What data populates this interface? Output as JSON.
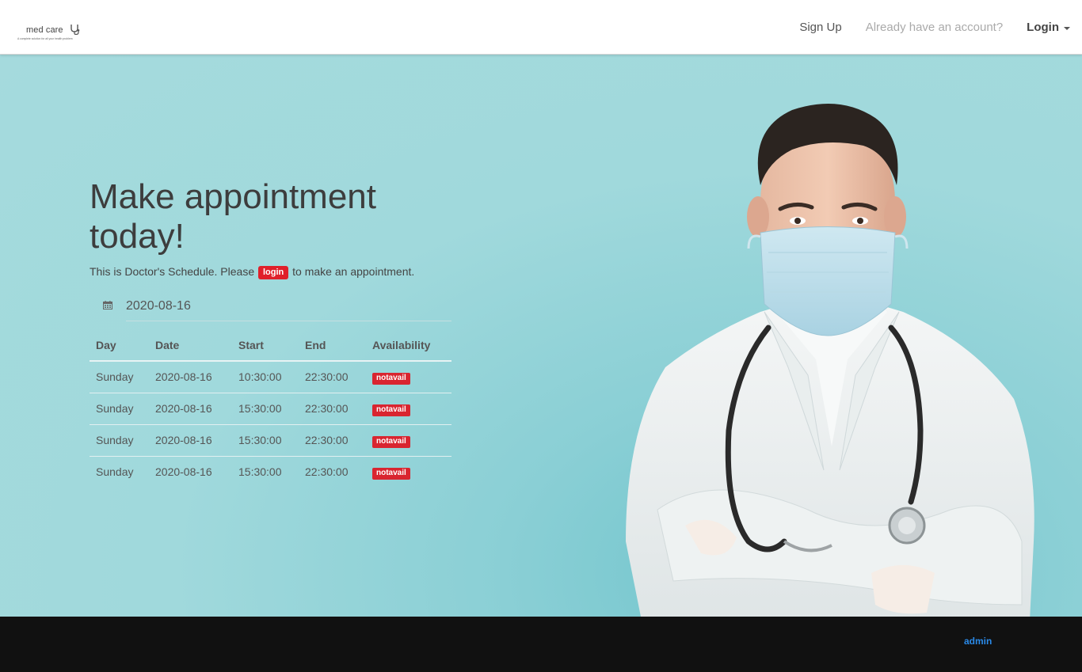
{
  "brand": {
    "name": "med care",
    "tagline": "A complete solution for all your health problem"
  },
  "nav": {
    "signup": "Sign Up",
    "already": "Already have an account?",
    "login": "Login"
  },
  "hero": {
    "headline": "Make appointment today!",
    "subtext_before": "This is Doctor's Schedule. Please",
    "login_badge": "login",
    "subtext_after": "to make an appointment.",
    "date_value": "2020-08-16"
  },
  "schedule": {
    "headers": [
      "Day",
      "Date",
      "Start",
      "End",
      "Availability"
    ],
    "rows": [
      [
        "Sunday",
        "2020-08-16",
        "10:30:00",
        "22:30:00",
        "notavail"
      ],
      [
        "Sunday",
        "2020-08-16",
        "15:30:00",
        "22:30:00",
        "notavail"
      ],
      [
        "Sunday",
        "2020-08-16",
        "15:30:00",
        "22:30:00",
        "notavail"
      ],
      [
        "Sunday",
        "2020-08-16",
        "15:30:00",
        "22:30:00",
        "notavail"
      ]
    ]
  },
  "footer": {
    "link": "admin"
  },
  "colors": {
    "hero_bg": "#a0d9dc",
    "badge_red": "#e0202a",
    "footer_bg": "#111111",
    "footer_link": "#2a8ae8"
  },
  "icons": {
    "calendar": "calendar-icon",
    "stethoscope": "stethoscope-icon",
    "caret": "caret-down-icon"
  }
}
